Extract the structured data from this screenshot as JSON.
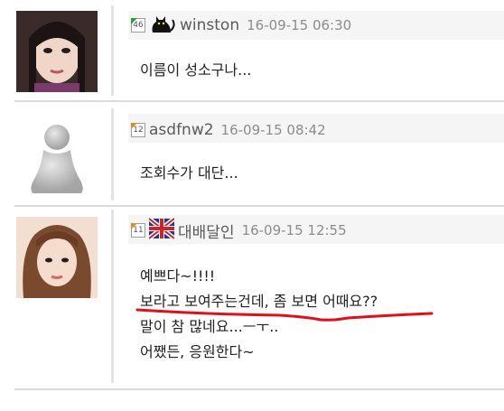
{
  "comments": [
    {
      "level": "46",
      "nickname": "winston",
      "date": "16-09-15 06:30",
      "lines": [
        "이름이 성소구나..."
      ]
    },
    {
      "level": "12",
      "nickname": "asdfnw2",
      "date": "16-09-15 08:42",
      "lines": [
        "조회수가 대단..."
      ]
    },
    {
      "level": "11",
      "nickname": "대배달인",
      "date": "16-09-15 12:55",
      "lines": [
        "예쁘다~!!!!",
        "보라고 보여주는건데, 좀 보면 어때요??",
        "말이 참 많네요...ㅡㅜ..",
        "어쨌든, 응원한다~"
      ]
    }
  ],
  "colors": {
    "underline": "#e0101a",
    "level_corner_orange": "#e18a2b",
    "level_corner_green": "#2a9d39"
  }
}
